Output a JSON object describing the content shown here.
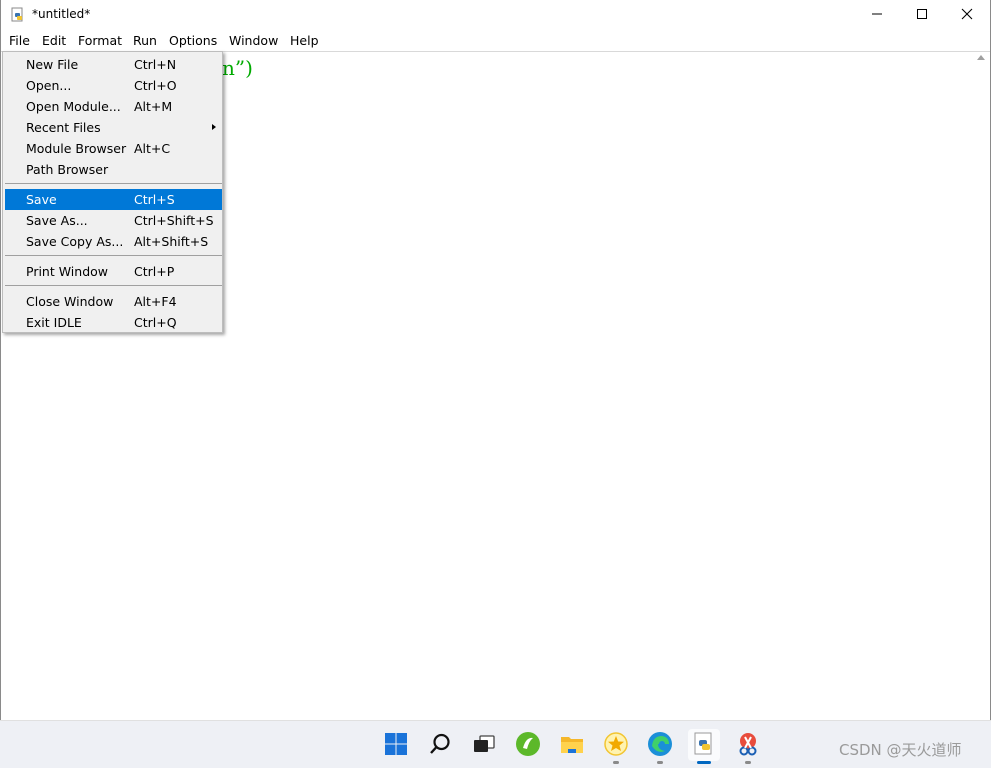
{
  "window": {
    "title": "*untitled*",
    "app_icon": "python-idle-icon",
    "controls": [
      "minimize-icon",
      "maximize-icon",
      "close-icon"
    ]
  },
  "menubar": {
    "items": [
      "File",
      "Edit",
      "Format",
      "Run",
      "Options",
      "Window",
      "Help"
    ]
  },
  "editor": {
    "visible_code_tail": "n”)"
  },
  "file_menu": {
    "items": [
      {
        "label": "New File",
        "accelerator": "Ctrl+N"
      },
      {
        "label": "Open...",
        "accelerator": "Ctrl+O"
      },
      {
        "label": "Open Module...",
        "accelerator": "Alt+M"
      },
      {
        "label": "Recent Files",
        "accelerator": "",
        "submenu": true
      },
      {
        "label": "Module Browser",
        "accelerator": "Alt+C"
      },
      {
        "label": "Path Browser",
        "accelerator": ""
      },
      {
        "label": "Save",
        "accelerator": "Ctrl+S",
        "selected": true
      },
      {
        "label": "Save As...",
        "accelerator": "Ctrl+Shift+S"
      },
      {
        "label": "Save Copy As...",
        "accelerator": "Alt+Shift+S"
      },
      {
        "label": "Print Window",
        "accelerator": "Ctrl+P"
      },
      {
        "label": "Close Window",
        "accelerator": "Alt+F4"
      },
      {
        "label": "Exit IDLE",
        "accelerator": "Ctrl+Q"
      }
    ],
    "highlight_color": "#0078d7"
  },
  "taskbar": {
    "icons": [
      "windows-start-icon",
      "search-icon",
      "task-view-icon",
      "browser-icon",
      "file-explorer-icon",
      "star-app-icon",
      "edge-icon",
      "python-idle-icon",
      "scissors-app-icon"
    ],
    "active_icon": "python-idle-icon"
  },
  "watermark": "CSDN @天火道师"
}
